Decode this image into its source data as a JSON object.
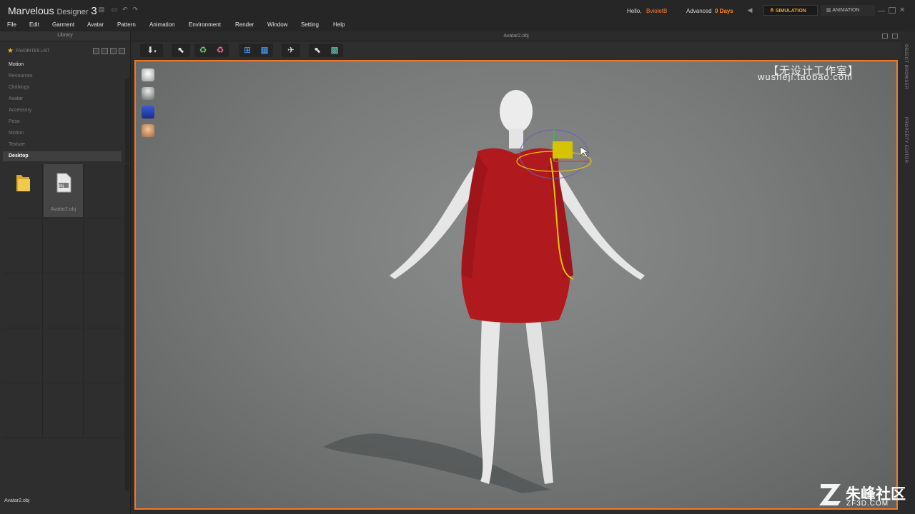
{
  "app": {
    "title_main": "Marvelous",
    "title_sub": "Designer",
    "title_version": "3",
    "greeting": "Hello,",
    "username": "BvioletB",
    "license_type": "Advanced",
    "license_days": "0 Days",
    "mode_simulation": "SIMULATION",
    "mode_animation": "ANIMATION"
  },
  "menu": [
    "File",
    "Edit",
    "Garment",
    "Avatar",
    "Pattern",
    "Animation",
    "Environment",
    "Render",
    "Window",
    "Setting",
    "Help"
  ],
  "library": {
    "header": "Library",
    "favorites_label": "FAVORITES LIST",
    "items": [
      "Motion",
      "Resources",
      "Clothings",
      "Avatar",
      "Accessory",
      "Pose",
      "Motion",
      "Texture",
      "Desktop"
    ],
    "active_item": "Desktop",
    "files": [
      {
        "name": "",
        "icon": "folder-icon"
      },
      {
        "name": "Avatar2.obj",
        "icon": "obj-file-icon",
        "badge": "obj"
      }
    ],
    "status_path": "Avatar2.obj"
  },
  "viewport": {
    "title": "Avatar2.obj",
    "watermark_cn": "【无设计工作室】",
    "watermark_url": "wusheji.taobao.com"
  },
  "right_tabs": [
    "OBJECT BROWSER",
    "PROPERTY EDITOR"
  ],
  "logo": {
    "cn": "朱峰社区",
    "domain": "ZF3D.COM"
  },
  "colors": {
    "accent_orange": "#f07a2a",
    "dress_red": "#b01a1f",
    "gizmo_yellow": "#d6c400"
  }
}
